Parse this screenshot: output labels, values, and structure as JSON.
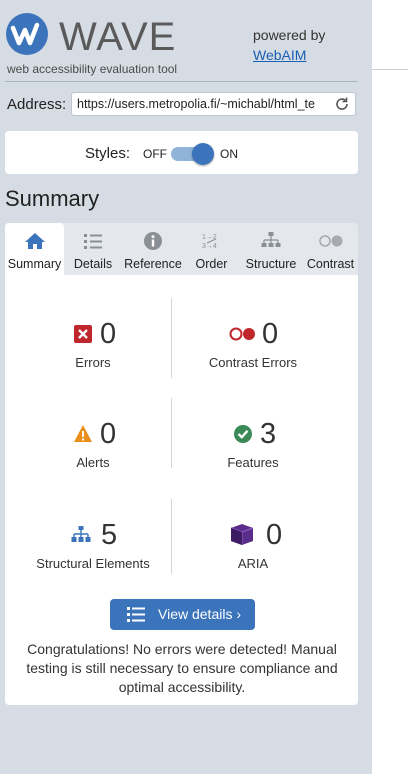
{
  "header": {
    "brand": "WAVE",
    "tagline": "web accessibility evaluation tool",
    "powered_by": "powered by",
    "webaim_link": "WebAIM"
  },
  "address": {
    "label": "Address:",
    "url": "https://users.metropolia.fi/~michabl/html_te"
  },
  "styles_toggle": {
    "label": "Styles:",
    "off": "OFF",
    "on": "ON",
    "state": "on"
  },
  "summary_title": "Summary",
  "tabs": [
    {
      "label": "Summary",
      "icon": "home-icon",
      "active": true
    },
    {
      "label": "Details",
      "icon": "list-icon",
      "active": false
    },
    {
      "label": "Reference",
      "icon": "info-icon",
      "active": false
    },
    {
      "label": "Order",
      "icon": "order-icon",
      "active": false
    },
    {
      "label": "Structure",
      "icon": "structure-icon",
      "active": false
    },
    {
      "label": "Contrast",
      "icon": "contrast-icon",
      "active": false
    }
  ],
  "stats": {
    "errors": {
      "count": "0",
      "label": "Errors"
    },
    "contrast_errors": {
      "count": "0",
      "label": "Contrast Errors"
    },
    "alerts": {
      "count": "0",
      "label": "Alerts"
    },
    "features": {
      "count": "3",
      "label": "Features"
    },
    "structural": {
      "count": "5",
      "label": "Structural Elements"
    },
    "aria": {
      "count": "0",
      "label": "ARIA"
    }
  },
  "view_details": "View details ›",
  "congrats": "Congratulations! No errors were detected! Manual testing is still necessary to ensure compliance and optimal accessibility.",
  "colors": {
    "accent": "#3b74ba",
    "panel_bg": "#d6dce4",
    "error_red": "#c0272d",
    "alert_orange": "#e8901a",
    "feature_green": "#3a8a58",
    "aria_purple": "#5b2d8a"
  }
}
